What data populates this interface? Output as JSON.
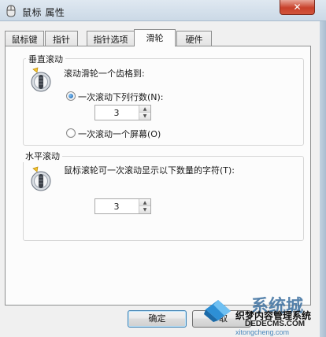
{
  "window": {
    "title": "鼠标 属性",
    "close_symbol": "✕"
  },
  "tabs": [
    {
      "label": "鼠标键",
      "active": false
    },
    {
      "label": "指针",
      "active": false
    },
    {
      "label": "指针选项",
      "active": false
    },
    {
      "label": "滑轮",
      "active": true
    },
    {
      "label": "硬件",
      "active": false
    }
  ],
  "vertical": {
    "group_label": "垂直滚动",
    "description": "滚动滑轮一个齿格到:",
    "option_lines_label": "一次滚动下列行数(N):",
    "option_lines_selected": true,
    "lines_value": "3",
    "option_screen_label": "一次滚动一个屏幕(O)",
    "option_screen_selected": false
  },
  "horizontal": {
    "group_label": "水平滚动",
    "description": "鼠标滚轮可一次滚动显示以下数量的字符(T):",
    "chars_value": "3"
  },
  "buttons": {
    "ok": "确定",
    "cancel_partial": "取"
  },
  "watermark": {
    "brand": "系统城",
    "site_cn": "织梦内容管理系统",
    "site_en": "DEDECMS.COM",
    "url": "xitongcheng.com"
  },
  "icons": {
    "title": "mouse-icon",
    "vertical_wheel": "scroll-wheel-icon",
    "horizontal_wheel": "scroll-wheel-icon"
  }
}
